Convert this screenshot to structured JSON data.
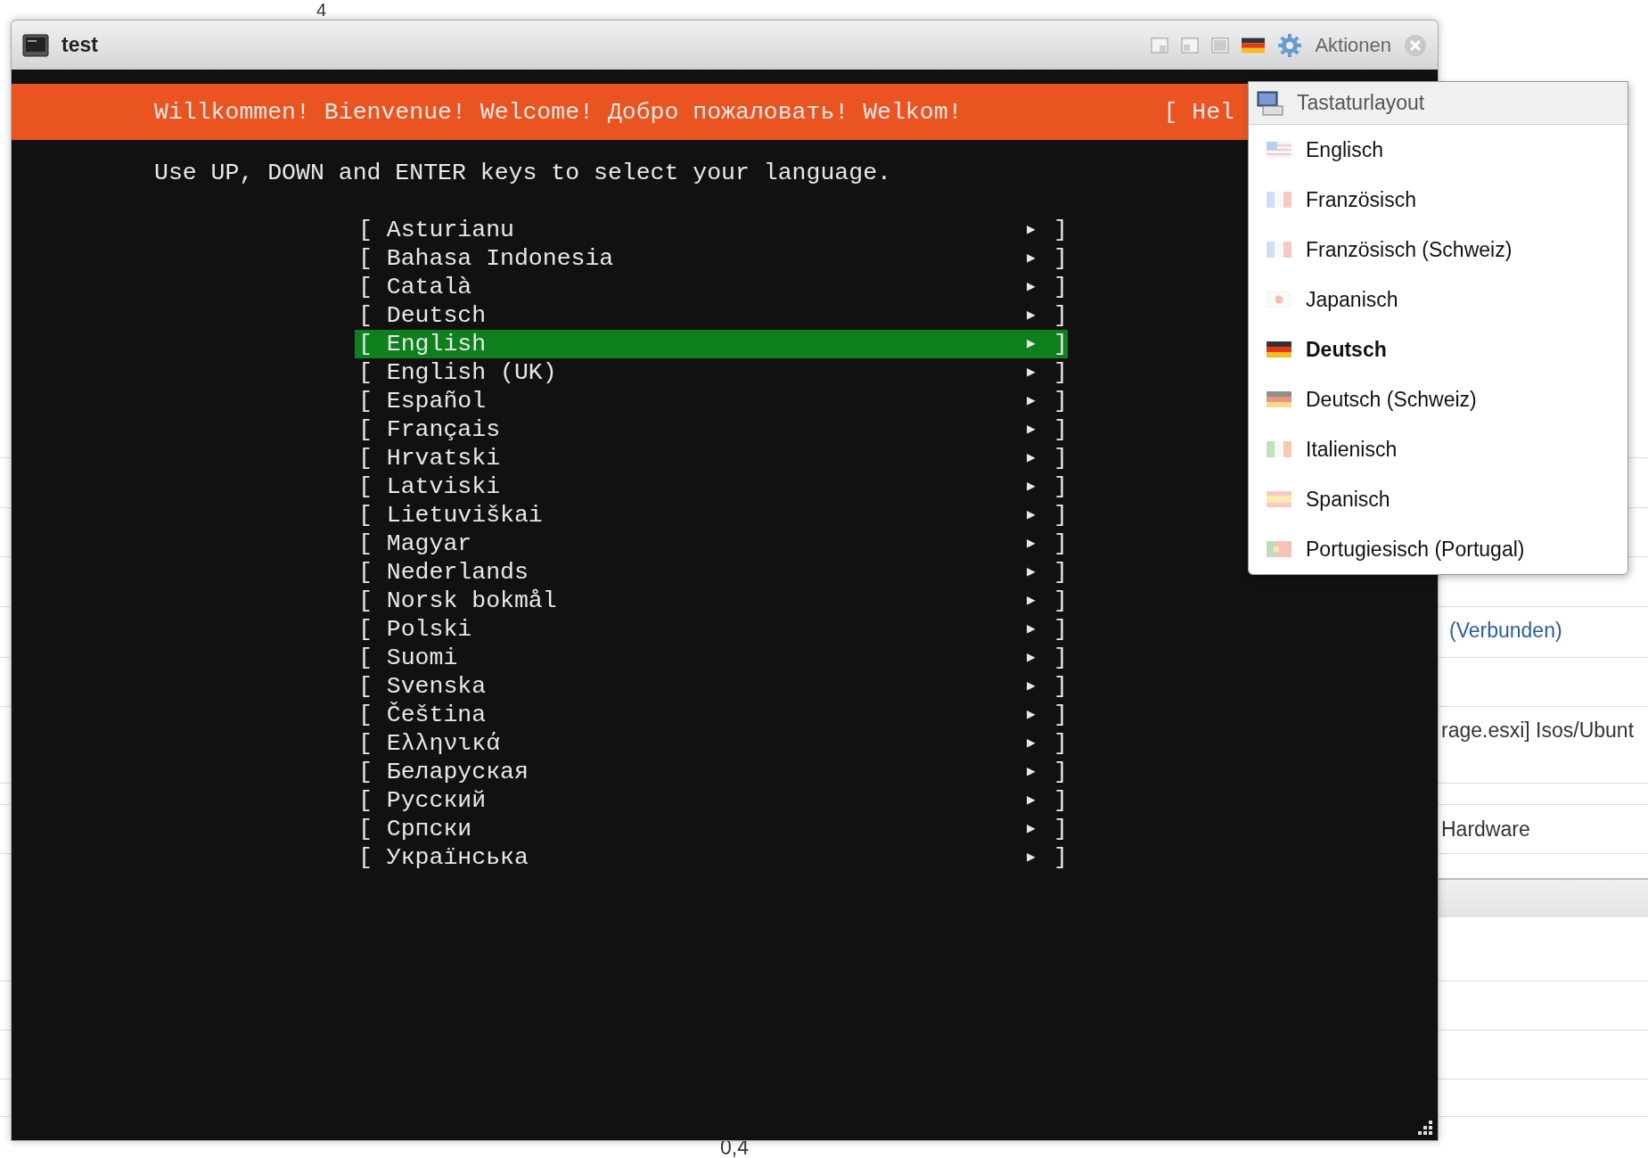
{
  "background": {
    "top_label": "4",
    "link": "(Verbunden)",
    "path": "rage.esxi] Isos/Ubunt",
    "section": "Hardware",
    "axis_label": "0,4"
  },
  "window": {
    "title": "test",
    "actions_label": "Aktionen"
  },
  "console": {
    "banner": "Willkommen! Bienvenue! Welcome! Добро пожаловать! Welkom!",
    "help": "[ Hel",
    "prompt": "Use UP, DOWN and ENTER keys to select your language.",
    "arrow": "▶",
    "open_bracket": "[",
    "close_bracket": "]",
    "languages": [
      {
        "label": "Asturianu",
        "selected": false
      },
      {
        "label": "Bahasa Indonesia",
        "selected": false
      },
      {
        "label": "Català",
        "selected": false
      },
      {
        "label": "Deutsch",
        "selected": false
      },
      {
        "label": "English",
        "selected": true
      },
      {
        "label": "English (UK)",
        "selected": false
      },
      {
        "label": "Español",
        "selected": false
      },
      {
        "label": "Français",
        "selected": false
      },
      {
        "label": "Hrvatski",
        "selected": false
      },
      {
        "label": "Latviski",
        "selected": false
      },
      {
        "label": "Lietuviškai",
        "selected": false
      },
      {
        "label": "Magyar",
        "selected": false
      },
      {
        "label": "Nederlands",
        "selected": false
      },
      {
        "label": "Norsk bokmål",
        "selected": false
      },
      {
        "label": "Polski",
        "selected": false
      },
      {
        "label": "Suomi",
        "selected": false
      },
      {
        "label": "Svenska",
        "selected": false
      },
      {
        "label": "Čeština",
        "selected": false
      },
      {
        "label": "Ελληνικά",
        "selected": false
      },
      {
        "label": "Беларуская",
        "selected": false
      },
      {
        "label": "Русский",
        "selected": false
      },
      {
        "label": "Српски",
        "selected": false
      },
      {
        "label": "Українська",
        "selected": false
      }
    ]
  },
  "keyboard_menu": {
    "title": "Tastaturlayout",
    "items": [
      {
        "label": "Englisch",
        "kind": "us",
        "selected": false
      },
      {
        "label": "Französisch",
        "kind": "fr",
        "selected": false
      },
      {
        "label": "Französisch (Schweiz)",
        "kind": "fr",
        "selected": false
      },
      {
        "label": "Japanisch",
        "kind": "jp",
        "selected": false
      },
      {
        "label": "Deutsch",
        "kind": "de",
        "selected": true
      },
      {
        "label": "Deutsch (Schweiz)",
        "kind": "de",
        "selected": false
      },
      {
        "label": "Italienisch",
        "kind": "it",
        "selected": false
      },
      {
        "label": "Spanisch",
        "kind": "es",
        "selected": false
      },
      {
        "label": "Portugiesisch (Portugal)",
        "kind": "pt",
        "selected": false
      }
    ]
  }
}
